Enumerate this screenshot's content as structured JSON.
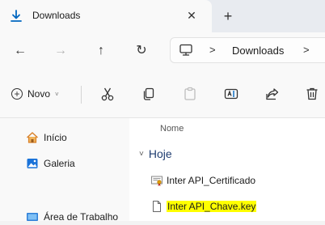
{
  "tab": {
    "title": "Downloads",
    "close_symbol": "✕",
    "new_tab_symbol": "+"
  },
  "nav": {
    "back_symbol": "←",
    "forward_symbol": "→",
    "up_symbol": "↑",
    "refresh_symbol": "↻"
  },
  "address": {
    "separator": ">",
    "crumb": "Downloads"
  },
  "toolbar": {
    "new_label": "Novo",
    "new_chevron": "˅",
    "actions": [
      "cut-icon",
      "copy-icon",
      "paste-icon",
      "rename-icon",
      "share-icon",
      "delete-icon"
    ]
  },
  "sidebar": {
    "items": [
      {
        "label": "Início",
        "icon": "home-icon"
      },
      {
        "label": "Galeria",
        "icon": "gallery-icon"
      },
      {
        "label": "Área de Trabalho",
        "icon": "desktop-icon"
      }
    ]
  },
  "files": {
    "column_header": "Nome",
    "group_label": "Hoje",
    "group_chevron": "˅",
    "items": [
      {
        "name": "Inter API_Certificado",
        "icon": "certificate-file-icon",
        "highlighted": false
      },
      {
        "name": "Inter API_Chave.key",
        "icon": "blank-file-icon",
        "highlighted": true
      }
    ]
  },
  "colors": {
    "accent": "#0067c0",
    "highlight": "#ffff00",
    "group_text": "#1f3d70"
  }
}
